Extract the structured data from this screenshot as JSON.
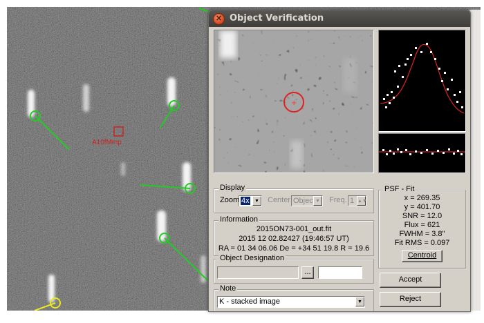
{
  "window": {
    "title": "Object Verification"
  },
  "image": {
    "annotation_label": "A10fMmp",
    "marker_color": "#22cc22"
  },
  "display": {
    "group_label": "Display",
    "zoom_label": "Zoom",
    "zoom_value": "4x",
    "center_label": "Center",
    "center_value": "Object",
    "freq_label": "Freq.",
    "freq_value": "1"
  },
  "information": {
    "group_label": "Information",
    "filename": "2015ON73-001_out.fit",
    "datetime": "2015 12 02.82427 (19:46:57 UT)",
    "coords": "RA = 01 34 06.06   De = +34 51 19.8   R = 19.6"
  },
  "designation": {
    "group_label": "Object Designation",
    "browse_label": "..."
  },
  "note": {
    "group_label": "Note",
    "value": "K - stacked image"
  },
  "psf": {
    "group_label": "PSF - Fit",
    "lines": [
      "x = 269.35",
      "y = 401.70",
      "SNR = 12.0",
      "Flux = 621",
      "FWHM = 3.8\"",
      "Fit RMS = 0.097"
    ],
    "centroid_label": "Centroid",
    "curve_color": "#cc2222"
  },
  "buttons": {
    "accept": "Accept",
    "reject": "Reject"
  }
}
